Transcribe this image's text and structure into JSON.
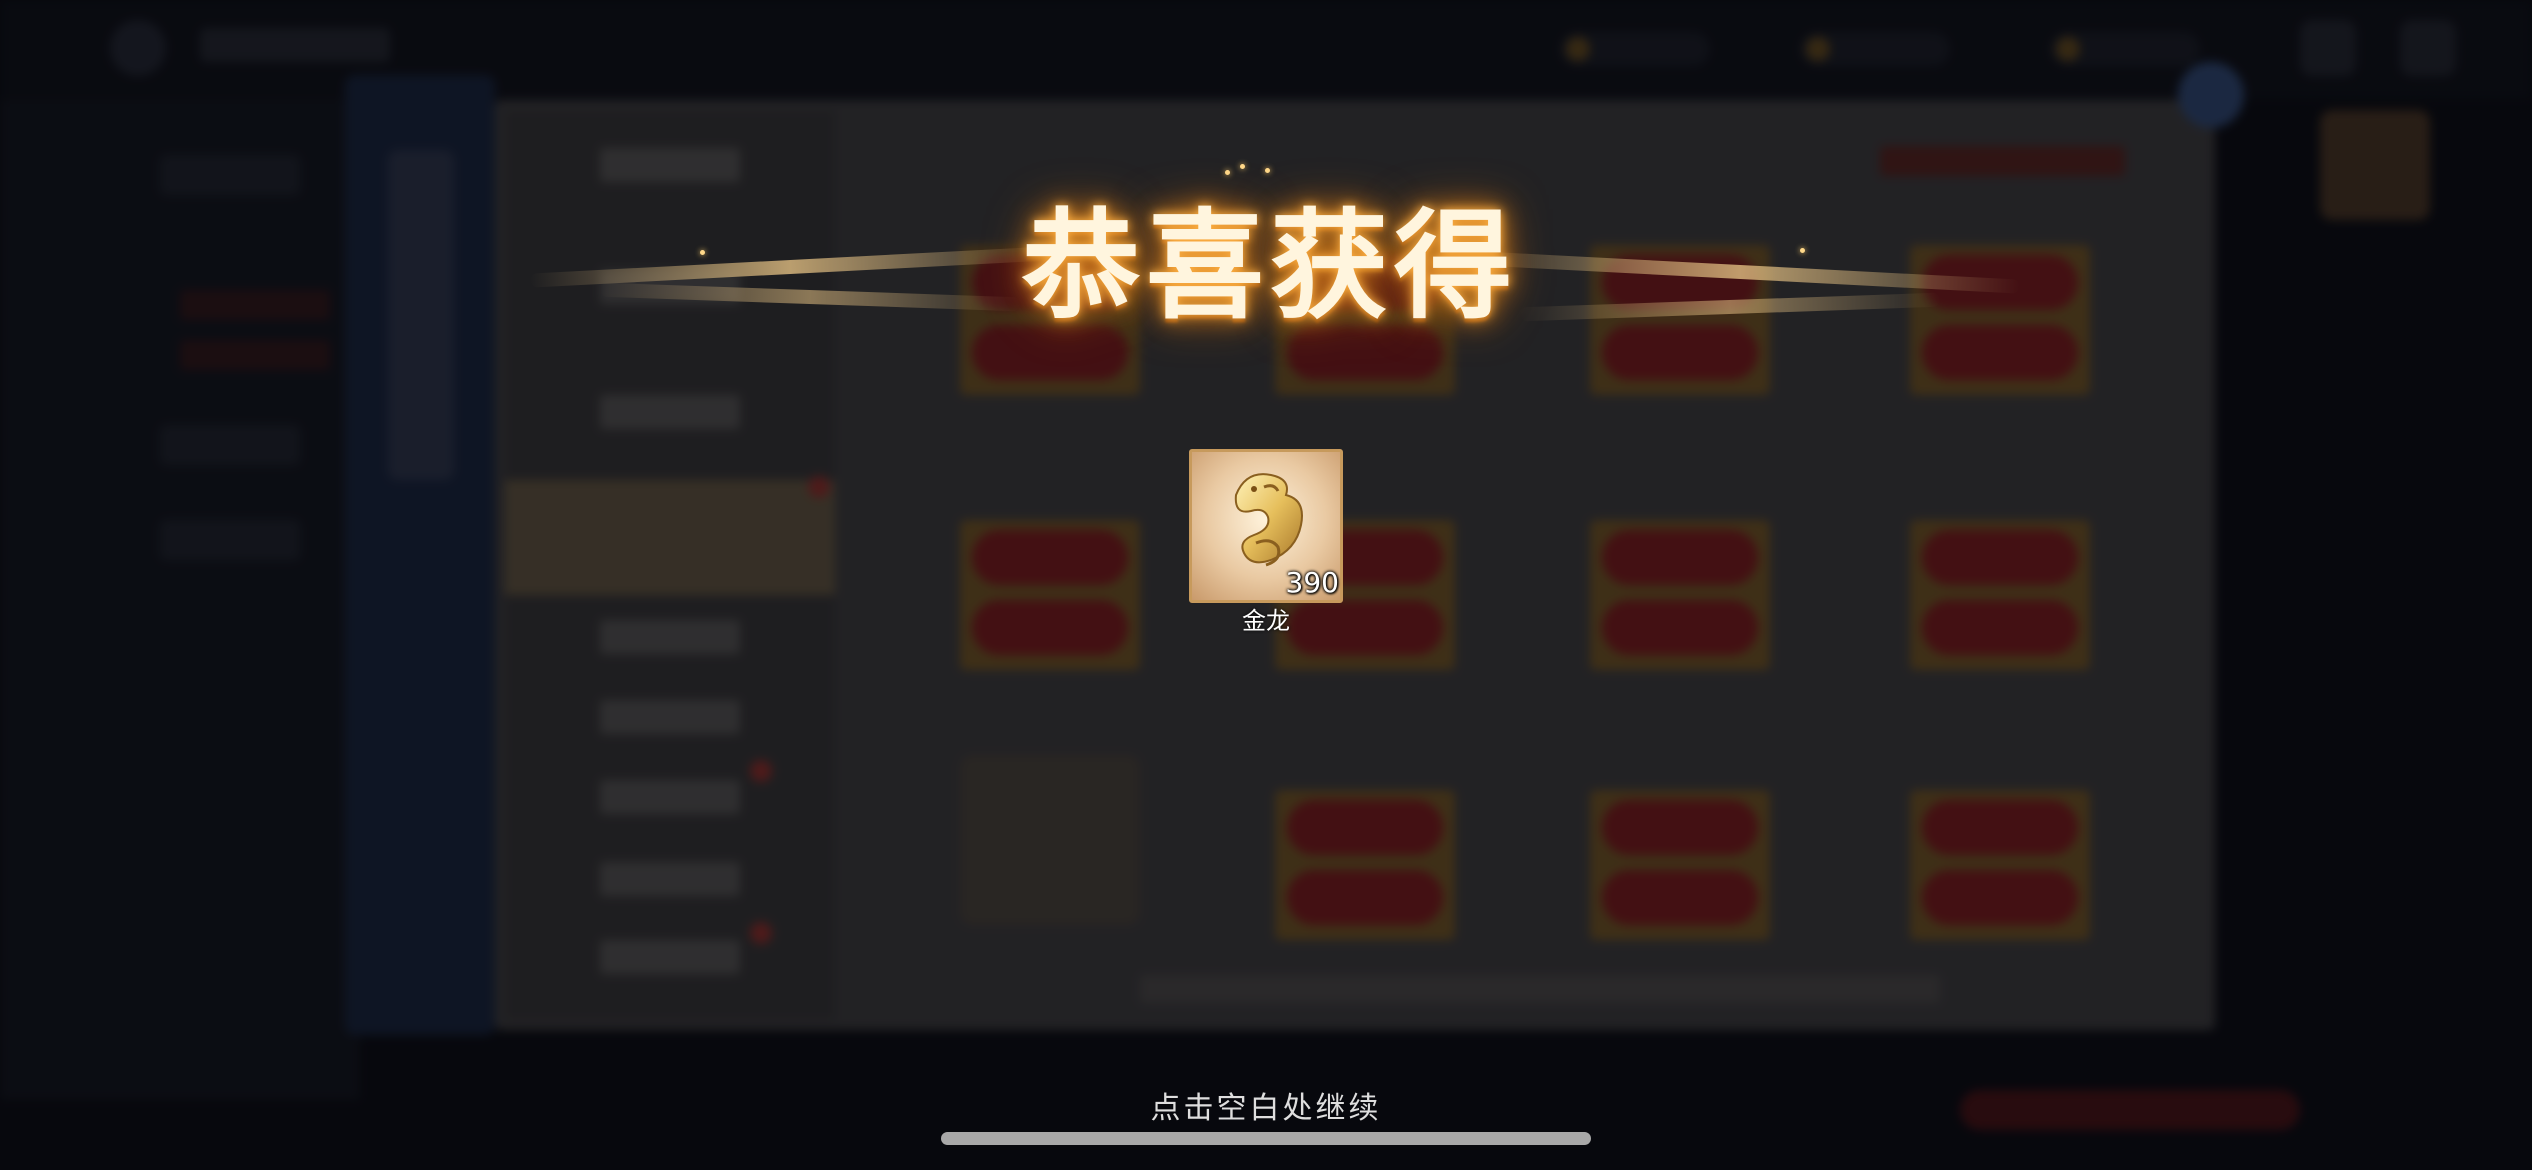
{
  "title": "恭喜获得",
  "reward": {
    "name": "金龙",
    "count": "390",
    "icon": "golden-dragon-icon"
  },
  "hint": "点击空白处继续",
  "colors": {
    "title_glow": "#e08a20",
    "frame_border": "#c79a5c",
    "overlay": "#05060a"
  }
}
